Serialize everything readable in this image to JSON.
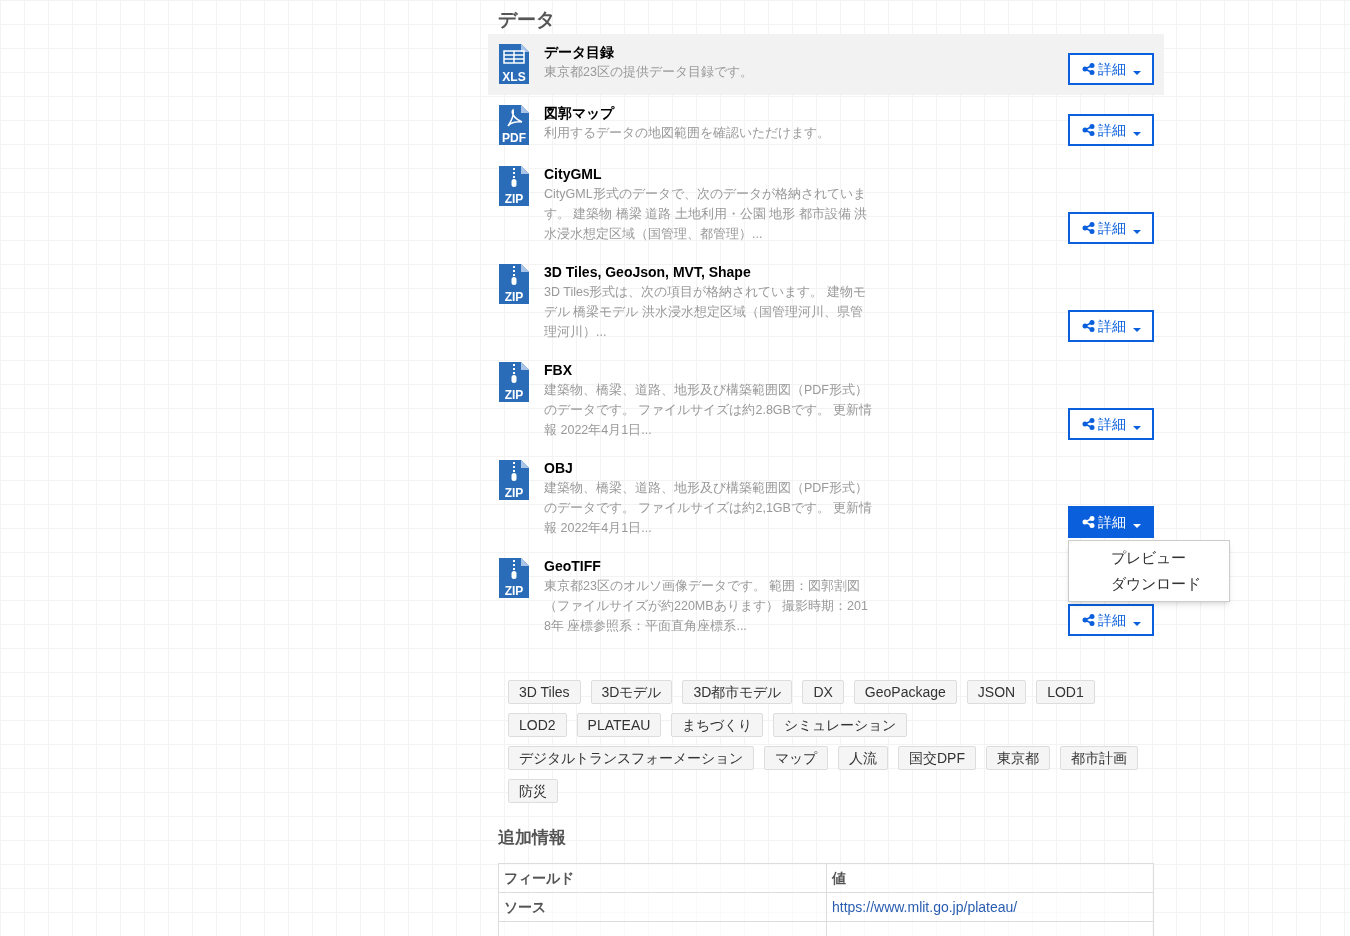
{
  "section_title": "データ",
  "resources": [
    {
      "kind": "xls",
      "icon_label": "XLS",
      "title": "データ目録",
      "description": "東京都23区の提供データ目録です。",
      "button": "詳細",
      "highlighted": true,
      "open": false
    },
    {
      "kind": "pdf",
      "icon_label": "PDF",
      "title": "図郭マップ",
      "description": "利用するデータの地図範囲を確認いただけます。",
      "button": "詳細",
      "highlighted": false,
      "open": false
    },
    {
      "kind": "zip",
      "icon_label": "ZIP",
      "title": "CityGML",
      "description": "CityGML形式のデータで、次のデータが格納されています。 建築物 橋梁 道路 土地利用・公園 地形 都市設備 洪水浸水想定区域（国管理、都管理）...",
      "button": "詳細",
      "highlighted": false,
      "open": false
    },
    {
      "kind": "zip",
      "icon_label": "ZIP",
      "title": "3D Tiles, GeoJson, MVT, Shape",
      "description": "3D Tiles形式は、次の項目が格納されています。 建物モデル 橋梁モデル 洪水浸水想定区域（国管理河川、県管理河川）...",
      "button": "詳細",
      "highlighted": false,
      "open": false
    },
    {
      "kind": "zip",
      "icon_label": "ZIP",
      "title": "FBX",
      "description": "建築物、橋梁、道路、地形及び構築範囲図（PDF形式）のデータです。 ファイルサイズは約2.8GBです。 更新情報 2022年4月1日...",
      "button": "詳細",
      "highlighted": false,
      "open": false
    },
    {
      "kind": "zip",
      "icon_label": "ZIP",
      "title": "OBJ",
      "description": "建築物、橋梁、道路、地形及び構築範囲図（PDF形式）のデータです。 ファイルサイズは約2,1GBです。 更新情報 2022年4月1日...",
      "button": "詳細",
      "highlighted": false,
      "open": true,
      "menu": [
        "プレビュー",
        "ダウンロード"
      ]
    },
    {
      "kind": "zip",
      "icon_label": "ZIP",
      "title": "GeoTIFF",
      "description": "東京都23区のオルソ画像データです。 範囲：図郭割図（ファイルサイズが約220MBあります） 撮影時期：2018年 座標参照系：平面直角座標系...",
      "button": "詳細",
      "highlighted": false,
      "open": false
    }
  ],
  "tags": [
    "3D Tiles",
    "3Dモデル",
    "3D都市モデル",
    "DX",
    "GeoPackage",
    "JSON",
    "LOD1",
    "LOD2",
    "PLATEAU",
    "まちづくり",
    "シミュレーション",
    "デジタルトランスフォーメーション",
    "マップ",
    "人流",
    "国交DPF",
    "東京都",
    "都市計画",
    "防災"
  ],
  "additional_info": {
    "title": "追加情報",
    "columns": [
      "フィールド",
      "値"
    ],
    "rows": [
      {
        "field": "ソース",
        "value": "https://www.mlit.go.jp/plateau/"
      }
    ]
  }
}
